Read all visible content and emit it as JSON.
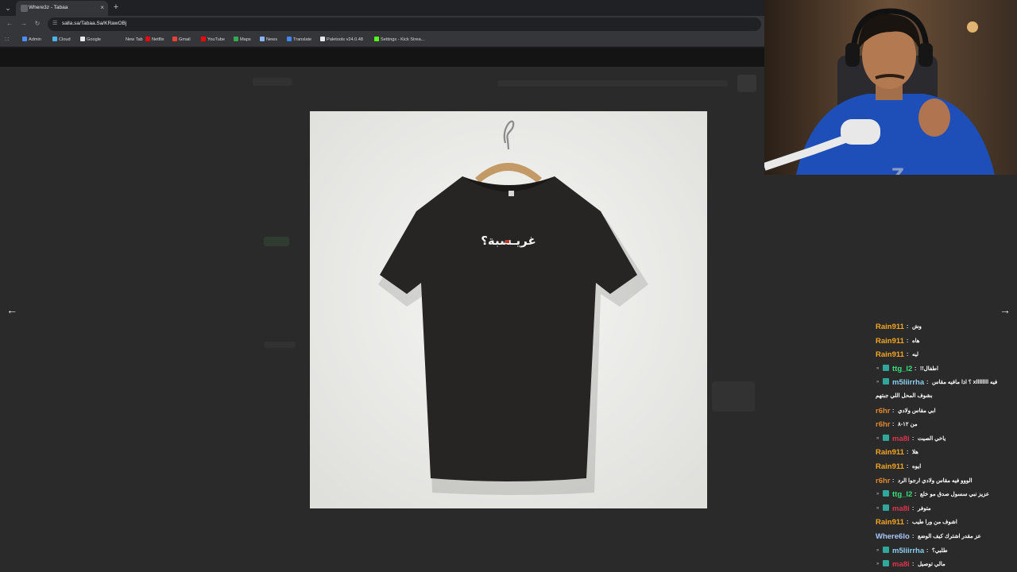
{
  "browser": {
    "tab_menu_icon": "⌄",
    "tab_title": "Where3z - Tabaa",
    "tab_close": "×",
    "new_tab": "+",
    "back": "←",
    "forward": "→",
    "reload": "↻",
    "site_info_icon": "☰",
    "url": "salla.sa/Tabaa.Sa/KRawOBj",
    "apps_icon": "∷",
    "bookmarks": [
      {
        "label": "Admin",
        "color": "#4d8ef7"
      },
      {
        "label": "Cloud",
        "color": "#4fb3e8"
      },
      {
        "label": "Google",
        "color": "#e8eaed"
      },
      {
        "label": "New Tab",
        "color": "#35363a"
      },
      {
        "label": "Netflix",
        "color": "#e50914"
      },
      {
        "label": "Gmail",
        "color": "#ea4335"
      },
      {
        "label": "YouTube",
        "color": "#ff0000"
      },
      {
        "label": "Maps",
        "color": "#34a853"
      },
      {
        "label": "News",
        "color": "#8ab4f8"
      },
      {
        "label": "Translate",
        "color": "#4285f4"
      },
      {
        "label": "Paletools v24.0.48",
        "color": "#e8eaed"
      },
      {
        "label": "Settings - Kick Strea...",
        "color": "#53fc18"
      }
    ]
  },
  "lightbox": {
    "prev_arrow": "←",
    "next_arrow": "→",
    "shirt_print": "غريـسبة؟",
    "shirt_color": "#262523",
    "print_accent": "#c0392b"
  },
  "webcam": {
    "watermark": "Z"
  },
  "chat": {
    "badge_icon": "»",
    "separator": ":",
    "messages": [
      {
        "user": "Rain911",
        "color": "#f5a623",
        "badges": false,
        "text": "وش"
      },
      {
        "user": "Rain911",
        "color": "#f5a623",
        "badges": false,
        "text": "هاه"
      },
      {
        "user": "Rain911",
        "color": "#f5a623",
        "badges": false,
        "text": "ليه"
      },
      {
        "user": "ttg_l2",
        "color": "#36e17a",
        "badges": true,
        "text": "!!اطفال"
      },
      {
        "user": "m5liirrha",
        "color": "#8ccff0",
        "badges": true,
        "text": "؟ اذا مافيه مقاس xllllllll فيه",
        "cont": "بشوف المحل اللي جبتهم"
      },
      {
        "user": "r6hr",
        "color": "#e1862c",
        "badges": false,
        "text": "ابي مقاس ولادي"
      },
      {
        "user": "r6hr",
        "color": "#e1862c",
        "badges": false,
        "text": "من ١٢-٨"
      },
      {
        "user": "ma8i",
        "color": "#e0324d",
        "badges": true,
        "text": "ياخي الصيت"
      },
      {
        "user": "Rain911",
        "color": "#f5a623",
        "badges": false,
        "text": "هلا"
      },
      {
        "user": "Rain911",
        "color": "#f5a623",
        "badges": false,
        "text": "ايوه"
      },
      {
        "user": "r6hr",
        "color": "#e1862c",
        "badges": false,
        "text": "الووو فيه مقاس ولادي ارجوا الرد"
      },
      {
        "user": "ttg_l2",
        "color": "#36e17a",
        "badges": true,
        "text": "عزيز نبي سسول صدق مو خلع"
      },
      {
        "user": "ma8i",
        "color": "#e0324d",
        "badges": true,
        "text": "متوفر"
      },
      {
        "user": "Rain911",
        "color": "#f5a623",
        "badges": false,
        "text": "اشوف من ورا طيب"
      },
      {
        "user": "Where6lo",
        "color": "#a9c7ff",
        "badges": false,
        "text": "عز مقدر اشترك كيف الوضع"
      },
      {
        "user": "m5liirrha",
        "color": "#8ccff0",
        "badges": true,
        "text": "طلبي؟"
      },
      {
        "user": "ma8i",
        "color": "#e0324d",
        "badges": true,
        "text": "مالي توصيل"
      }
    ]
  }
}
